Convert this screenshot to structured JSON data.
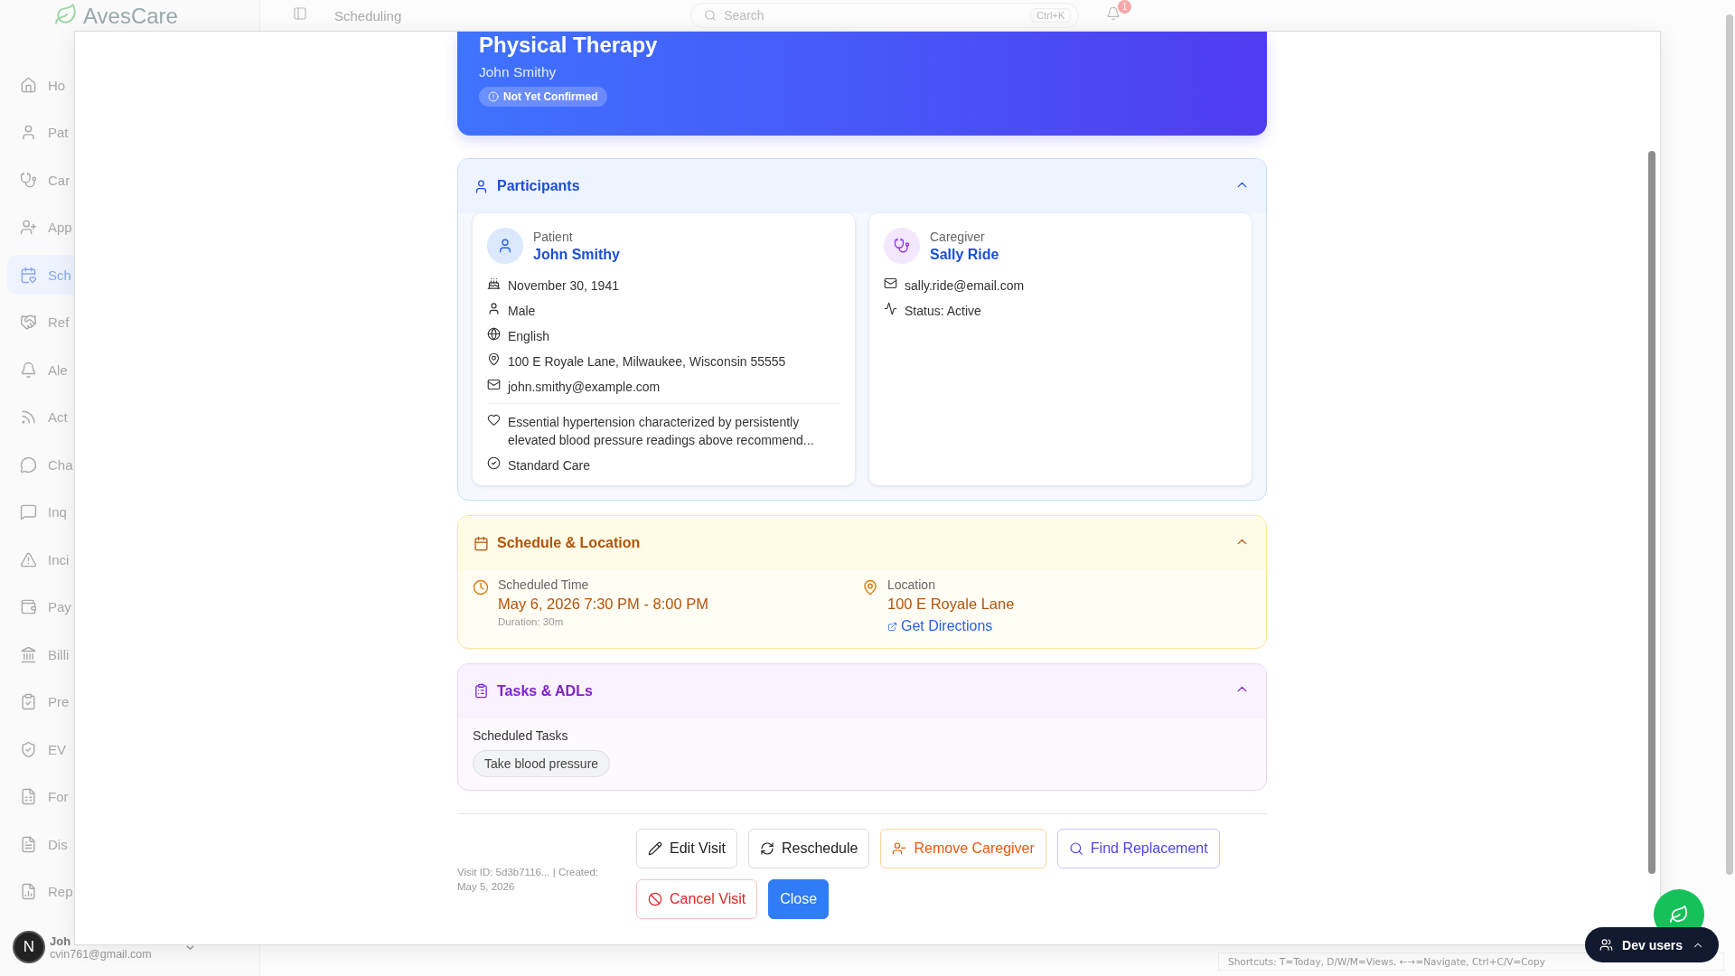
{
  "app": {
    "logo": "AvesCare",
    "page_title": "Scheduling",
    "search": {
      "placeholder": "Search",
      "shortcut": "Ctrl+K"
    },
    "notifications": {
      "count": "1"
    }
  },
  "sidebar": {
    "items": [
      {
        "label": "Ho",
        "selected": false
      },
      {
        "label": "Pat",
        "selected": false
      },
      {
        "label": "Car",
        "selected": false
      },
      {
        "label": "App",
        "selected": false
      },
      {
        "label": "Sch",
        "selected": true
      },
      {
        "label": "Ref",
        "selected": false
      },
      {
        "label": "Ale",
        "selected": false
      },
      {
        "label": "Act",
        "selected": false
      },
      {
        "label": "Cha",
        "selected": false
      },
      {
        "label": "Inq",
        "selected": false
      },
      {
        "label": "Inci",
        "selected": false
      },
      {
        "label": "Pay",
        "selected": false
      },
      {
        "label": "Billi",
        "selected": false
      },
      {
        "label": "Pre",
        "selected": false
      },
      {
        "label": "EV",
        "selected": false
      },
      {
        "label": "For",
        "selected": false
      },
      {
        "label": "Dis",
        "selected": false
      },
      {
        "label": "Rep",
        "selected": false
      }
    ],
    "user": {
      "avatar": "N",
      "name": "Joh",
      "email": "cvin761@gmail.com"
    }
  },
  "modal": {
    "header": {
      "title": "Physical Therapy",
      "subtitle": "John Smithy",
      "status": "Not Yet Confirmed"
    },
    "sections": [
      {
        "kind": "participants",
        "title": "Participants",
        "expanded": true,
        "people": [
          {
            "kind": "patient",
            "role": "Patient",
            "name": "John Smithy",
            "details": [
              "November 30, 1941",
              "Male",
              "English",
              "100 E Royale Lane, Milwaukee, Wisconsin 55555",
              "john.smithy@example.com"
            ],
            "notes": [
              "Essential hypertension characterized by persistently elevated blood pressure readings above recommend...",
              "Standard Care"
            ]
          },
          {
            "kind": "caregiver",
            "role": "Caregiver",
            "name": "Sally Ride",
            "details": [
              "sally.ride@email.com",
              "Status: Active"
            ]
          }
        ]
      },
      {
        "kind": "schedule",
        "title": "Schedule & Location",
        "expanded": true,
        "time": {
          "label": "Scheduled Time",
          "value": "May 6, 2026 7:30 PM - 8:00 PM",
          "duration": "Duration: 30m"
        },
        "location": {
          "label": "Location",
          "value": "100 E Royale Lane",
          "link": "Get Directions"
        }
      },
      {
        "kind": "tasks",
        "title": "Tasks & ADLs",
        "expanded": true,
        "subtitle": "Scheduled Tasks",
        "tasks": [
          "Take blood pressure"
        ]
      }
    ],
    "footer": {
      "meta": "Visit ID: 5d3b7116... | Created: May 5, 2026",
      "buttons": [
        {
          "kind": "edit",
          "label": "Edit Visit"
        },
        {
          "kind": "reschedule",
          "label": "Reschedule"
        },
        {
          "kind": "remove",
          "label": "Remove Caregiver"
        },
        {
          "kind": "find",
          "label": "Find Replacement"
        },
        {
          "kind": "cancel",
          "label": "Cancel Visit"
        },
        {
          "kind": "close",
          "label": "Close"
        }
      ]
    }
  },
  "shortcuts": "Shortcuts: T=Today, D/W/M=Views, ←→=Navigate, Ctrl+C/V=Copy",
  "dev_users": {
    "label": "Dev users"
  }
}
